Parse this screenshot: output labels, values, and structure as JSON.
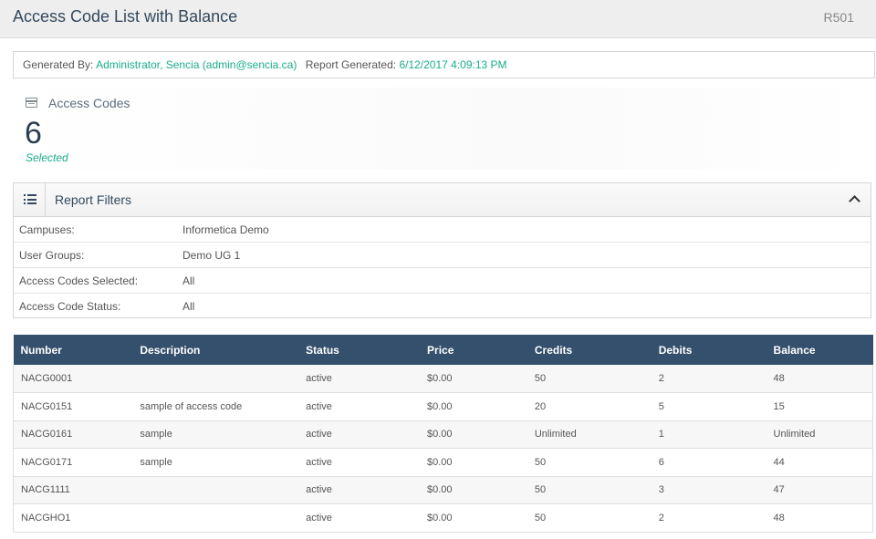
{
  "header": {
    "title": "Access Code List with Balance",
    "report_code": "R501"
  },
  "generated": {
    "by_label": "Generated By:",
    "by_value": "Administrator, Sencia (admin@sencia.ca)",
    "at_label": "Report Generated:",
    "at_value": "6/12/2017 4:09:13 PM"
  },
  "stat": {
    "label": "Access Codes",
    "value": "6",
    "sub": "Selected",
    "icon": "credit-card-icon"
  },
  "filters": {
    "title": "Report Filters",
    "icon": "list-icon",
    "rows": [
      {
        "label": "Campuses:",
        "value": "Informetica Demo"
      },
      {
        "label": "User Groups:",
        "value": "Demo UG 1"
      },
      {
        "label": "Access Codes Selected:",
        "value": "All"
      },
      {
        "label": "Access Code Status:",
        "value": "All"
      }
    ]
  },
  "table": {
    "columns": [
      "Number",
      "Description",
      "Status",
      "Price",
      "Credits",
      "Debits",
      "Balance"
    ],
    "rows": [
      [
        "NACG0001",
        "",
        "active",
        "$0.00",
        "50",
        "2",
        "48"
      ],
      [
        "NACG0151",
        "sample of access code",
        "active",
        "$0.00",
        "20",
        "5",
        "15"
      ],
      [
        "NACG0161",
        "sample",
        "active",
        "$0.00",
        "Unlimited",
        "1",
        "Unlimited"
      ],
      [
        "NACG0171",
        "sample",
        "active",
        "$0.00",
        "50",
        "6",
        "44"
      ],
      [
        "NACG1111",
        "",
        "active",
        "$0.00",
        "50",
        "3",
        "47"
      ],
      [
        "NACGHO1",
        "",
        "active",
        "$0.00",
        "50",
        "2",
        "48"
      ]
    ]
  },
  "colors": {
    "accent": "#1aad8b",
    "header_bg": "#34506d",
    "title_text": "#34495e"
  }
}
